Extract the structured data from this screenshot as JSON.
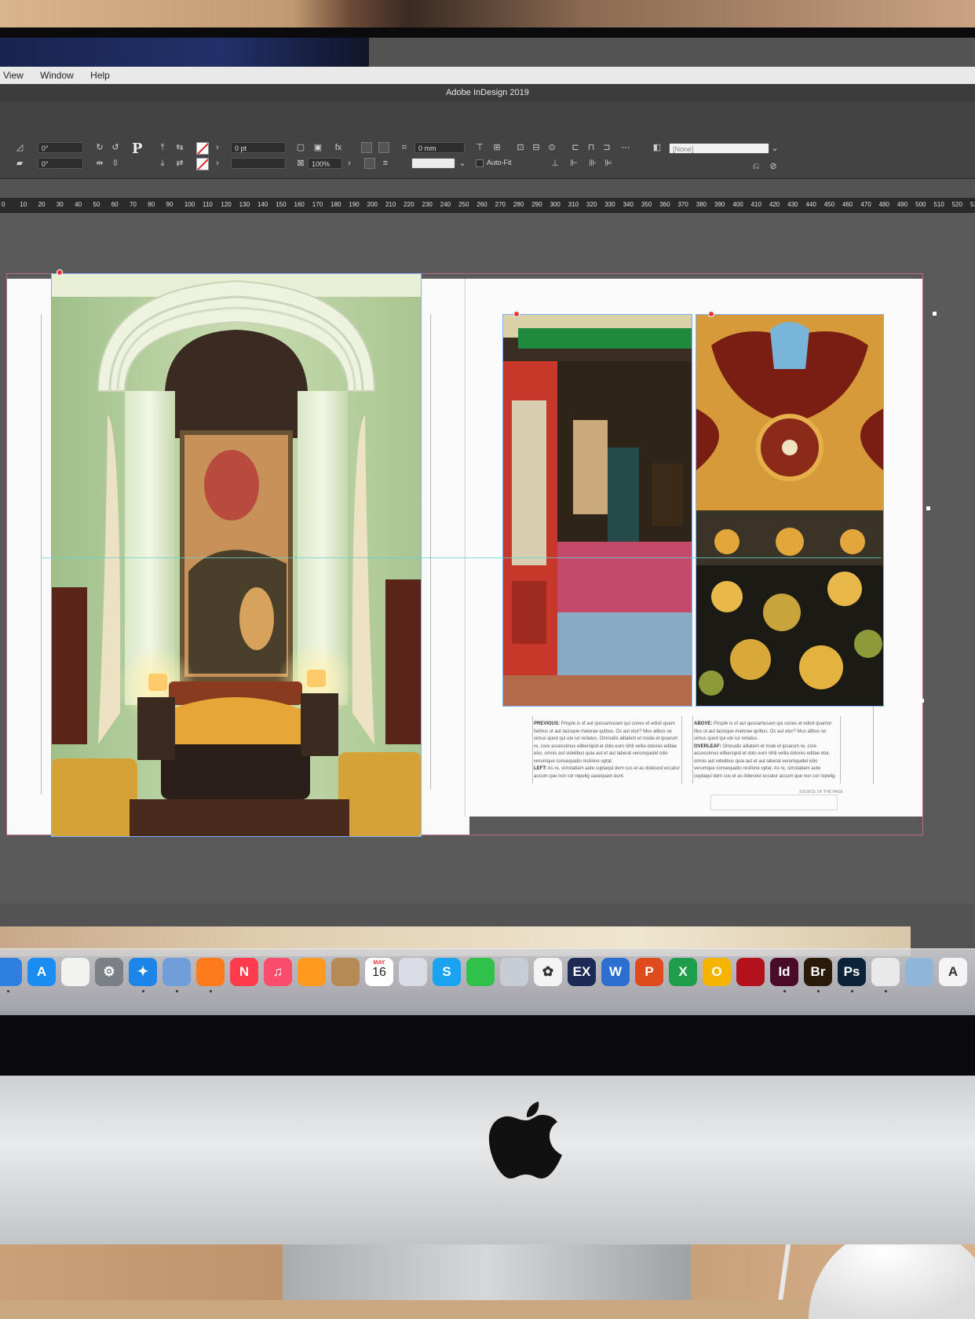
{
  "menubar": {
    "items": [
      "View",
      "Window",
      "Help"
    ]
  },
  "window": {
    "title": "Adobe InDesign 2019"
  },
  "control_panel": {
    "rotation_angle": "0°",
    "shear_angle": "0°",
    "stroke_weight": "0 pt",
    "scale_percent": "100%",
    "offset": "0 mm",
    "auto_fit_label": "Auto-Fit",
    "object_style": "[None]"
  },
  "ruler": {
    "ticks": [
      "0",
      "10",
      "20",
      "30",
      "40",
      "50",
      "60",
      "70",
      "80",
      "90",
      "100",
      "110",
      "120",
      "130",
      "140",
      "150",
      "160",
      "170",
      "180",
      "190",
      "200",
      "210",
      "220",
      "230",
      "240",
      "250",
      "260",
      "270",
      "280",
      "290",
      "300",
      "310",
      "320",
      "330",
      "340",
      "350",
      "360",
      "370",
      "380",
      "390",
      "400",
      "410",
      "420",
      "430",
      "440",
      "450",
      "460",
      "470",
      "480",
      "490",
      "500",
      "510",
      "520",
      "530"
    ]
  },
  "captions": {
    "left_column": [
      {
        "label": "PREVIOUS:",
        "text": "Prisple is of aut quosamusam qui cones et edisit quam faribus ut aut lacisque malorae quibus. Os aut etur? Mus alibus se simus quod qui ute iur reriatus. Omnudis alitatem et moda et ipsarum re, core accessimus elibersipid et dolo eum nihil vellia dolores editae etur, omnis aut videlibus quia aut et aut laberat verumquidel iolio verumque consequatio restione optat."
      },
      {
        "label": "LEFT:",
        "text": "As re, simstatiam aute cuptaqui dem cus et as dolecest eccatur accum que non cor repelig uasequam dunt."
      }
    ],
    "right_column": [
      {
        "label": "ABOVE:",
        "text": "Prisple is of aut quosamusam qui cones et edisit quamor illus ut aut lacisque malorae quibus. Os aut etur? Mus alibus se simus quod qui ute iur reriatus."
      },
      {
        "label": "OVERLEAF:",
        "text": "Omnudis alitatem et mole et ipsarum re, core accessimus elibersipid et dolo eum nihil vellia dolores editae etur, omnis aut videlibus quia aut et aut laberat verumquidel iolio verumque consequatio restione optat. As re, simstatiam aute cuptaqui dem cus et as dolecest eccatur accum que non cor repelig."
      }
    ],
    "folio": "SOURCE OF THE PAGE"
  },
  "calendar": {
    "month": "MAY",
    "day": "16"
  },
  "dock": [
    {
      "name": "finder",
      "label": "",
      "color": "#2f7fe0"
    },
    {
      "name": "app-store",
      "label": "A",
      "color": "#1b8cf2"
    },
    {
      "name": "notes",
      "label": "",
      "color": "#f2f2ee"
    },
    {
      "name": "system-preferences",
      "label": "⚙",
      "color": "#7b7f86"
    },
    {
      "name": "safari",
      "label": "✦",
      "color": "#1c86e8"
    },
    {
      "name": "preview",
      "label": "",
      "color": "#6f9ed8"
    },
    {
      "name": "firefox",
      "label": "",
      "color": "#ff7a1a"
    },
    {
      "name": "news",
      "label": "N",
      "color": "#ff3b4e"
    },
    {
      "name": "music",
      "label": "♫",
      "color": "#fa4d6b"
    },
    {
      "name": "books",
      "label": "",
      "color": "#ff9a1e"
    },
    {
      "name": "contacts",
      "label": "",
      "color": "#b58a55"
    },
    {
      "name": "calendar",
      "label": "",
      "color": "#ffffff"
    },
    {
      "name": "file-browser",
      "label": "",
      "color": "#d9dde3"
    },
    {
      "name": "skype",
      "label": "S",
      "color": "#1aa3f0"
    },
    {
      "name": "facetime",
      "label": "",
      "color": "#2fc14a"
    },
    {
      "name": "image-capture",
      "label": "",
      "color": "#c7cdd4"
    },
    {
      "name": "photos",
      "label": "✿",
      "color": "#f3f3f3"
    },
    {
      "name": "filemaker",
      "label": "EX",
      "color": "#1d2a55"
    },
    {
      "name": "word",
      "label": "W",
      "color": "#2b6fd0"
    },
    {
      "name": "powerpoint",
      "label": "P",
      "color": "#e04b1e"
    },
    {
      "name": "excel",
      "label": "X",
      "color": "#1e9e4a"
    },
    {
      "name": "outlook",
      "label": "O",
      "color": "#f5b400"
    },
    {
      "name": "acrobat",
      "label": "",
      "color": "#b3121a"
    },
    {
      "name": "indesign",
      "label": "Id",
      "color": "#4a0a2a"
    },
    {
      "name": "bridge",
      "label": "Br",
      "color": "#2a1a08"
    },
    {
      "name": "photoshop",
      "label": "Ps",
      "color": "#0b2238"
    },
    {
      "name": "chrome",
      "label": "",
      "color": "#e9e9e9"
    },
    {
      "name": "screenshot-tool",
      "label": "",
      "color": "#8fb5d9"
    },
    {
      "name": "text-edit",
      "label": "A",
      "color": "#f4f4f4"
    }
  ]
}
